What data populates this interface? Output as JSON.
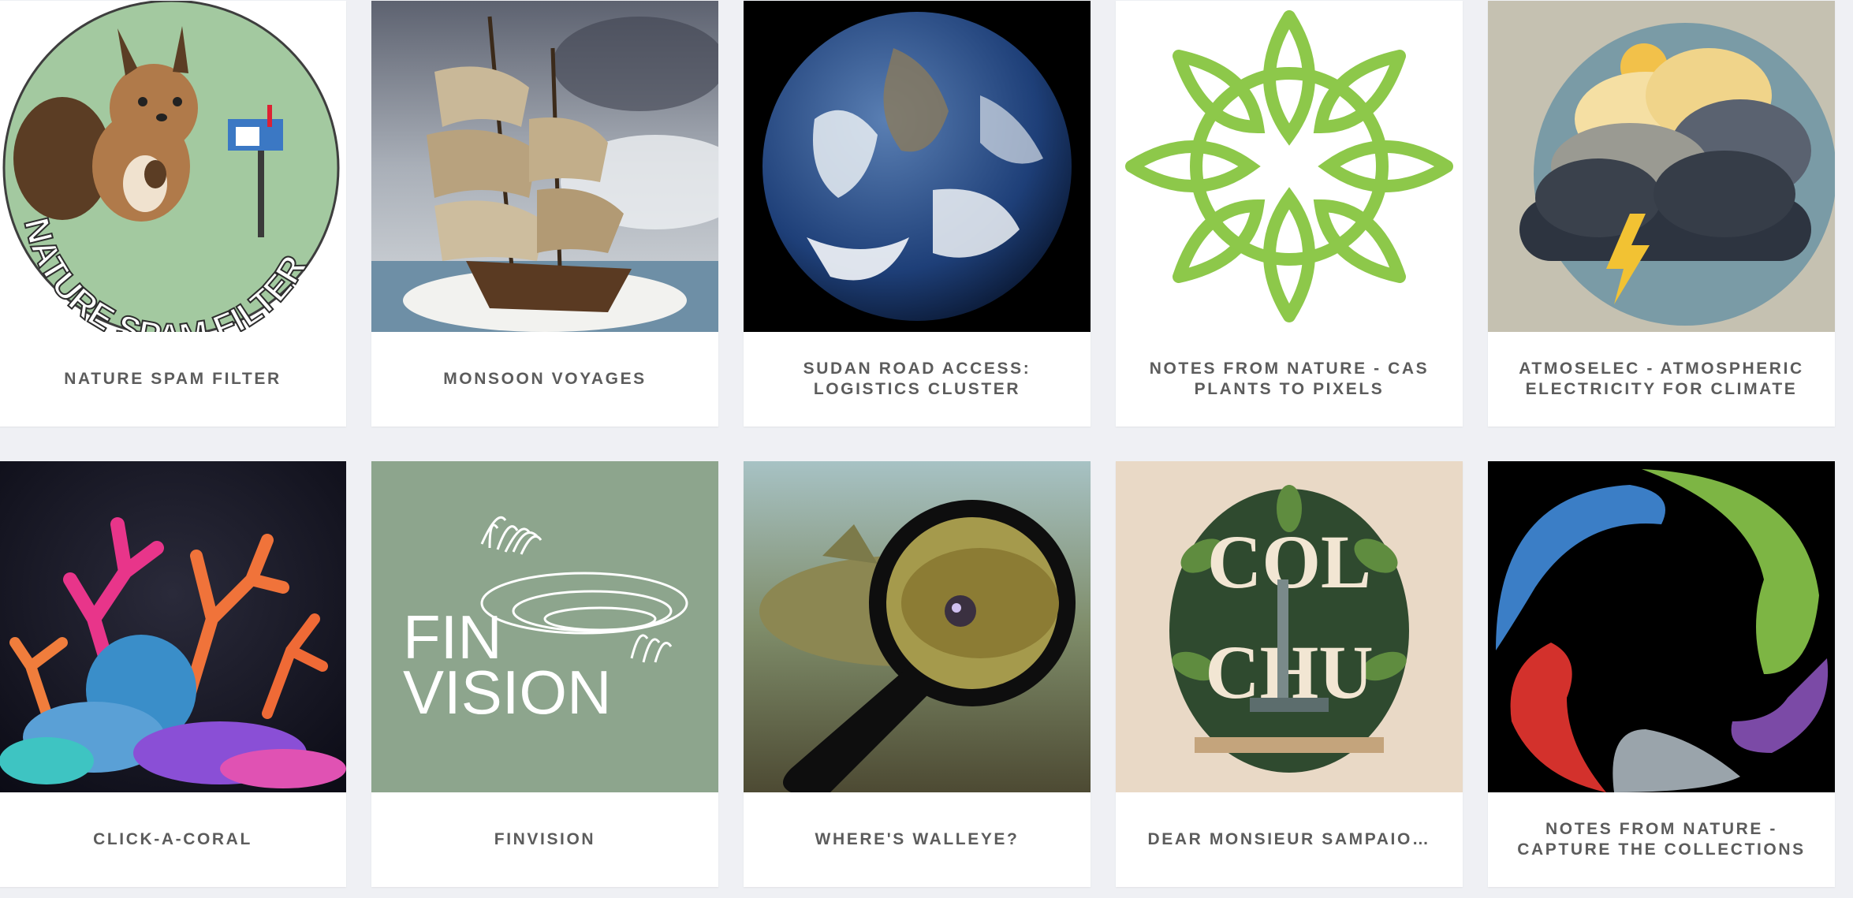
{
  "projects": [
    {
      "title": "NATURE SPAM FILTER",
      "image": "squirrel-mailbox-badge",
      "badge_text": "NATURE SPAM FILTER",
      "badge_color": "#a3c9a0"
    },
    {
      "title": "MONSOON VOYAGES",
      "image": "sailing-ship-painting"
    },
    {
      "title": "SUDAN ROAD ACCESS: LOGISTICS CLUSTER",
      "image": "earth-globe"
    },
    {
      "title": "NOTES FROM NATURE - CAS PLANTS TO PIXELS",
      "image": "green-floral-rosette",
      "accent": "#8dc84a"
    },
    {
      "title": "ATMOSELEC - ATMOSPHERIC ELECTRICITY FOR CLIMATE",
      "image": "storm-cloud-lightning"
    },
    {
      "title": "CLICK-A-CORAL",
      "image": "neon-coral-reef"
    },
    {
      "title": "FINVISION",
      "image": "finvision-logo",
      "logo_text_1": "FIN",
      "logo_text_2": "VISION",
      "logo_bg": "#8da58d"
    },
    {
      "title": "WHERE'S WALLEYE?",
      "image": "fish-magnifying-glass"
    },
    {
      "title": "DEAR MONSIEUR SAMPAIO…",
      "image": "botanical-monogram-microscope",
      "monogram": "COL CHU"
    },
    {
      "title": "NOTES FROM NATURE - CAPTURE THE COLLECTIONS",
      "image": "notes-from-nature-swirl-logo",
      "logo_colors": [
        "#3b7ec6",
        "#7db544",
        "#d3312c",
        "#7b4aa6",
        "#9aa4ab"
      ]
    }
  ]
}
